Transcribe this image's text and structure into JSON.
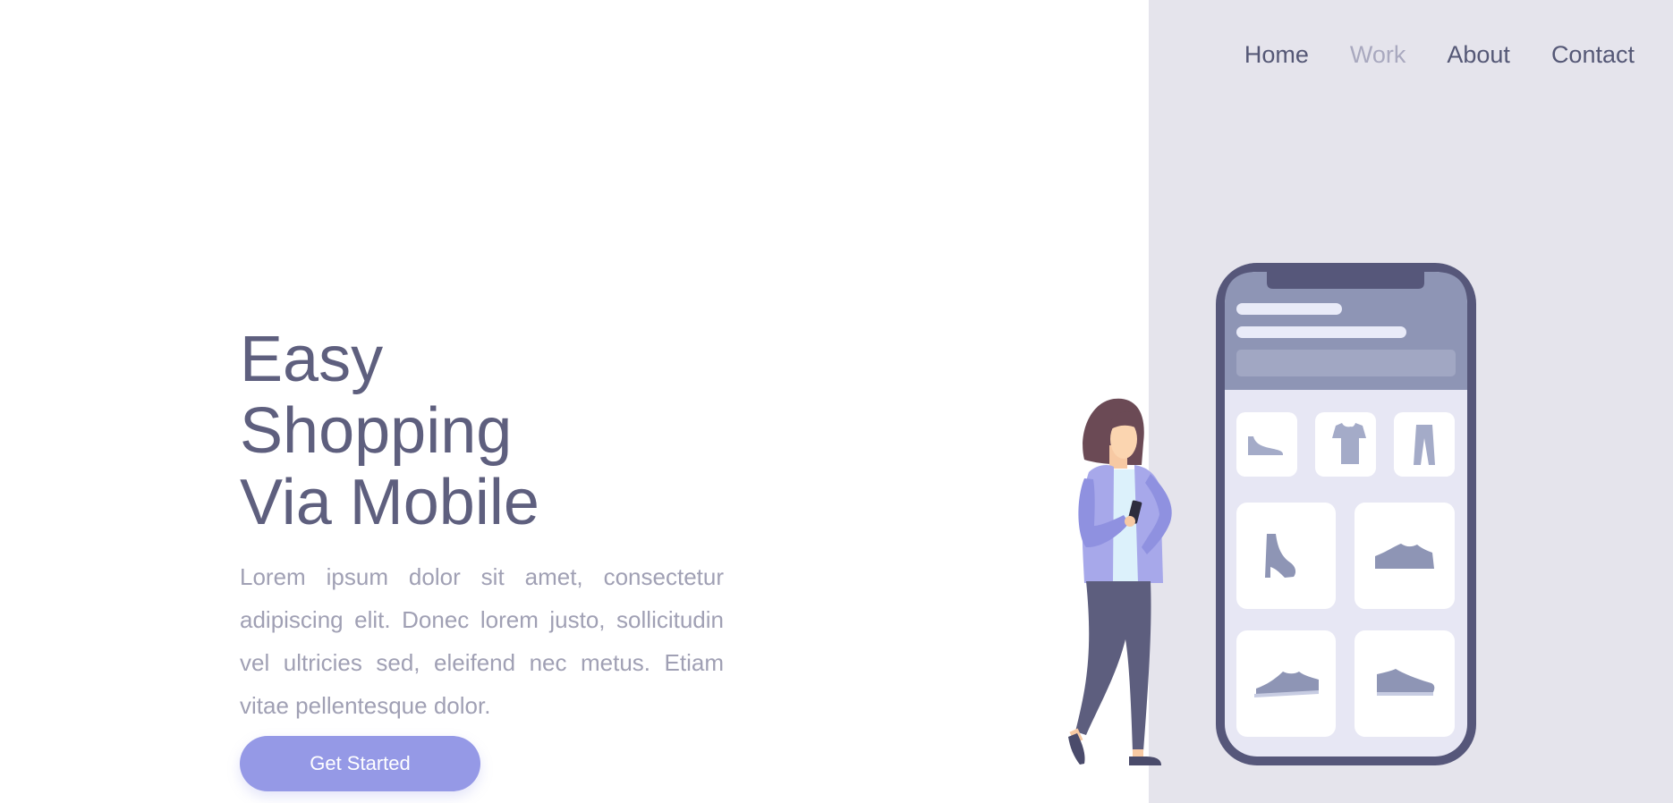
{
  "nav": {
    "items": [
      {
        "label": "Home",
        "active": false
      },
      {
        "label": "Work",
        "active": true
      },
      {
        "label": "About",
        "active": false
      },
      {
        "label": "Contact",
        "active": false
      }
    ]
  },
  "hero": {
    "title_lines": [
      "Easy",
      "Shopping",
      "Via Mobile"
    ],
    "description": "Lorem ipsum dolor sit amet, consectetur adipiscing elit. Donec lorem justo, sollicitudin vel ultricies sed, eleifend nec metus. Etiam vitae pellentesque dolor.",
    "cta_label": "Get Started"
  },
  "illustration": {
    "phone_categories": [
      "shoe-icon",
      "tshirt-icon",
      "pants-icon"
    ],
    "phone_products": [
      "high-heel-boot-icon",
      "sneaker-icon",
      "sneaker-icon",
      "sneaker-icon"
    ]
  },
  "colors": {
    "accent": "#9599e6",
    "heading": "#5e5f7e",
    "body_text": "#a0a0b4",
    "nav_text": "#555876",
    "nav_active": "#a9a9bf",
    "panel_bg": "#e5e4ec",
    "phone_frame": "#56577a",
    "phone_header": "#8e95b5"
  }
}
